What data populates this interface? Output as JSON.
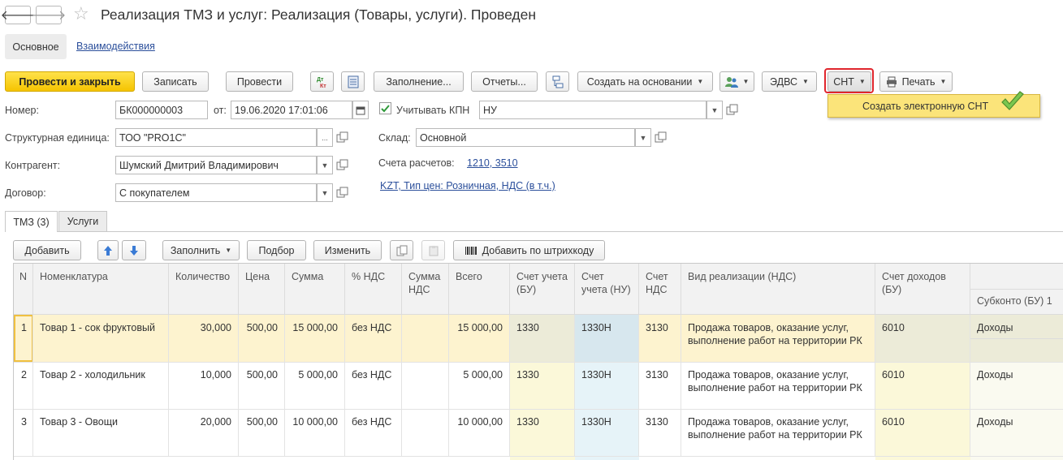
{
  "title": "Реализация ТМЗ и услуг: Реализация (Товары, услуги). Проведен",
  "nav": {
    "back": "🡐",
    "forward": "🡒"
  },
  "section_tabs": {
    "main": "Основное",
    "interactions": "Взаимодействия"
  },
  "toolbar": {
    "post_close": "Провести и закрыть",
    "write": "Записать",
    "post": "Провести",
    "dt_kt": "Дт Кт",
    "fill": "Заполнение...",
    "reports": "Отчеты...",
    "create_based": "Создать на основании",
    "edvs": "ЭДВС",
    "snt": "СНТ",
    "print": "Печать"
  },
  "snt_menu": {
    "item": "Создать электронную СНТ"
  },
  "form": {
    "number_label": "Номер:",
    "number_value": "БК000000003",
    "date_label": "от:",
    "date_value": "19.06.2020 17:01:06",
    "kpn_label": "Учитывать КПН",
    "kpn_value": "НУ",
    "unit_label": "Структурная единица:",
    "unit_value": "ТОО \"PRO1C\"",
    "warehouse_label": "Склад:",
    "warehouse_value": "Основной",
    "counterparty_label": "Контрагент:",
    "counterparty_value": "Шумский Дмитрий Владимирович",
    "accounts_label": "Счета расчетов:",
    "accounts_value": "1210, 3510",
    "contract_label": "Договор:",
    "contract_value": "С покупателем",
    "price_link": "KZT, Тип цен: Розничная, НДС (в т.ч.)",
    "ellipsis": "..."
  },
  "doc_tabs": {
    "tmz": "ТМЗ (3)",
    "services": "Услуги"
  },
  "table_toolbar": {
    "add": "Добавить",
    "fill": "Заполнить",
    "select": "Подбор",
    "change": "Изменить",
    "barcode": "Добавить по штрихкоду"
  },
  "table": {
    "columns": [
      "N",
      "Номенклатура",
      "Количество",
      "Цена",
      "Сумма",
      "% НДС",
      "Сумма НДС",
      "Всего",
      "Счет учета (БУ)",
      "Счет учета (НУ)",
      "Счет НДС",
      "Вид реализации (НДС)",
      "Счет доходов (БУ)",
      "Субконто (БУ) 1"
    ],
    "rows": [
      {
        "n": "1",
        "name": "Товар 1 - сок фруктовый",
        "qty": "30,000",
        "price": "500,00",
        "sum": "15 000,00",
        "vat_rate": "без НДС",
        "vat_sum": "",
        "total": "15 000,00",
        "acc_bu": "1330",
        "acc_nu": "1330Н",
        "acc_vat": "3130",
        "kind1": "Продажа товаров, оказание услуг,",
        "kind2": "выполнение работ на территории РК",
        "income": "6010",
        "subconto": "Доходы"
      },
      {
        "n": "2",
        "name": "Товар 2 - холодильник",
        "qty": "10,000",
        "price": "500,00",
        "sum": "5 000,00",
        "vat_rate": "без НДС",
        "vat_sum": "",
        "total": "5 000,00",
        "acc_bu": "1330",
        "acc_nu": "1330Н",
        "acc_vat": "3130",
        "kind1": "Продажа товаров, оказание услуг,",
        "kind2": "выполнение работ на территории РК",
        "income": "6010",
        "subconto": "Доходы"
      },
      {
        "n": "3",
        "name": "Товар 3 - Овощи",
        "qty": "20,000",
        "price": "500,00",
        "sum": "10 000,00",
        "vat_rate": "без НДС",
        "vat_sum": "",
        "total": "10 000,00",
        "acc_bu": "1330",
        "acc_nu": "1330Н",
        "acc_vat": "3130",
        "kind1": "Продажа товаров, оказание услуг,",
        "kind2": "выполнение работ на территории РК",
        "income": "6010",
        "subconto": "Доходы"
      }
    ]
  },
  "colors": {
    "accent_yellow": "#f5c400",
    "link": "#2b4f9b",
    "highlight_red": "#e0262d",
    "selected_row": "#fdf3cf"
  }
}
